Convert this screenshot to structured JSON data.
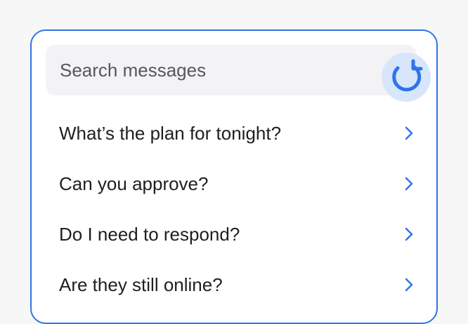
{
  "search": {
    "placeholder": "Search messages"
  },
  "refresh_icon": "refresh-icon",
  "suggestions": [
    {
      "label": "What’s the plan for tonight?"
    },
    {
      "label": "Can you approve?"
    },
    {
      "label": "Do I need to respond?"
    },
    {
      "label": "Are they still online?"
    }
  ],
  "colors": {
    "accent": "#2f74e8",
    "accent_soft": "#d7e6fb",
    "chevron": "#2f74e8"
  }
}
